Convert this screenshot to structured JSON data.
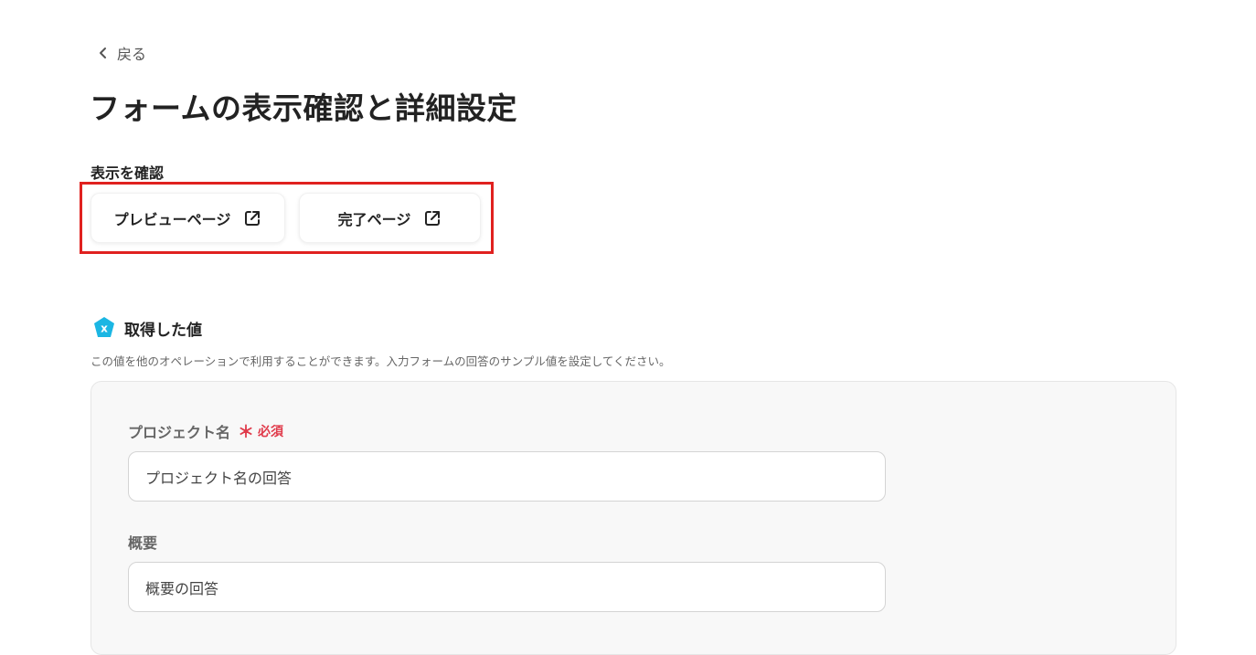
{
  "nav": {
    "back_label": "戻る"
  },
  "page": {
    "title": "フォームの表示確認と詳細設定"
  },
  "display_check": {
    "label": "表示を確認",
    "buttons": [
      {
        "label": "プレビューページ",
        "icon": "external-link-icon"
      },
      {
        "label": "完了ページ",
        "icon": "external-link-icon"
      }
    ],
    "highlight_color": "#e0211f"
  },
  "acquired_values": {
    "title": "取得した値",
    "icon": "variable-x-icon",
    "icon_color": "#1bb6e3",
    "description": "この値を他のオペレーションで利用することができます。入力フォームの回答のサンプル値を設定してください。",
    "fields": [
      {
        "label": "プロジェクト名",
        "required_mark": "＊",
        "required_text": "必須",
        "value": "プロジェクト名の回答"
      },
      {
        "label": "概要",
        "value": "概要の回答"
      }
    ]
  }
}
